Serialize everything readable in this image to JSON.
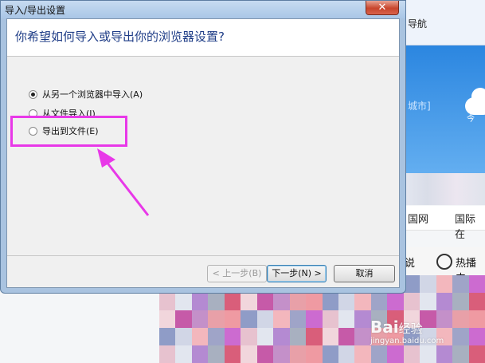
{
  "dialog": {
    "title": "导入/导出设置",
    "close_label": "✕",
    "question": "你希望如何导入或导出你的浏览器设置?",
    "options": [
      {
        "label": "从另一个浏览器中导入(A)",
        "checked": true
      },
      {
        "label": "从文件导入(I)",
        "checked": false
      },
      {
        "label": "导出到文件(E)",
        "checked": false
      }
    ],
    "buttons": {
      "back": "< 上一步(B)",
      "next": "下一步(N) >",
      "cancel": "取消"
    }
  },
  "background": {
    "nav_label": "导航",
    "weather_city": "城市]",
    "weather_today": "今",
    "links": [
      "国网",
      "国际在"
    ],
    "hot_label": "热播中",
    "said": "说",
    "watermark": "Bai",
    "watermark_tail": "经验",
    "watermark_sub": "jingyan.baidu.com"
  },
  "colors": {
    "annotation": "#e838e8",
    "question_text": "#1f3d87"
  }
}
